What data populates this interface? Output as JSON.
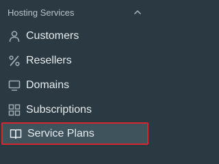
{
  "sidebar": {
    "section_title": "Hosting Services",
    "items": [
      {
        "label": "Customers",
        "icon": "user-icon"
      },
      {
        "label": "Resellers",
        "icon": "percent-icon"
      },
      {
        "label": "Domains",
        "icon": "monitor-icon"
      },
      {
        "label": "Subscriptions",
        "icon": "grid-icon"
      },
      {
        "label": "Service Plans",
        "icon": "book-icon",
        "selected": true
      }
    ]
  },
  "colors": {
    "background": "#2b3a42",
    "header_text": "#b8c3c9",
    "item_text": "#e7ecee",
    "icon": "#9eabb2",
    "selected_background": "#3f535d",
    "selected_border": "#d7262e"
  }
}
